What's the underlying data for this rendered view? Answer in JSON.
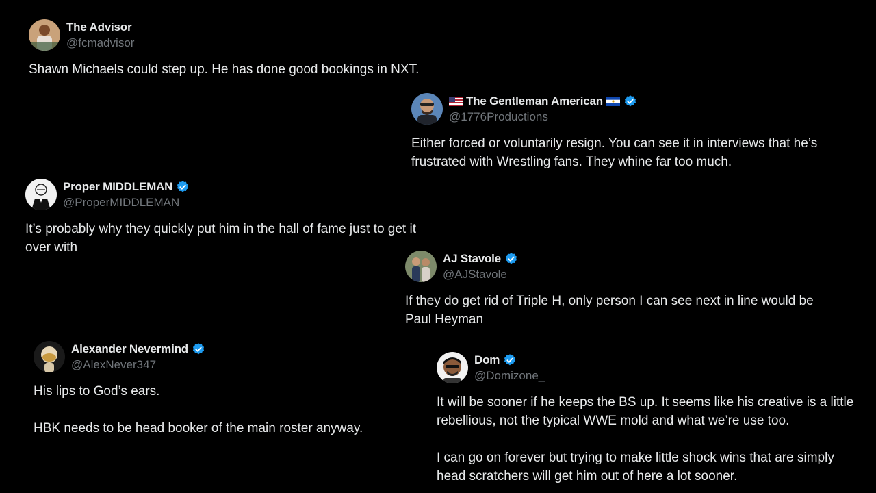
{
  "colors": {
    "background": "#000000",
    "text": "#e7e9ea",
    "secondary": "#71767b",
    "verified": "#1d9bf0"
  },
  "tweets": [
    {
      "name": "The Advisor",
      "handle": "@fcmadvisor",
      "verified": false,
      "text": "Shawn Michaels could step up. He has done good bookings in NXT."
    },
    {
      "name": "The Gentleman American",
      "handle": "@1776Productions",
      "verified": true,
      "flags": [
        "us-flag-icon",
        "el-salvador-flag-icon"
      ],
      "text": "Either forced or voluntarily resign. You can see it in interviews that he’s\nfrustrated with Wrestling fans. They whine far too much."
    },
    {
      "name": "Proper MIDDLEMAN",
      "handle": "@ProperMIDDLEMAN",
      "verified": true,
      "text": "It’s probably why they quickly put him in the hall of fame just to get it\nover with"
    },
    {
      "name": "AJ Stavole",
      "handle": "@AJStavole",
      "verified": true,
      "text": "If they do get rid of Triple H, only person I can see next in line would be\nPaul Heyman"
    },
    {
      "name": "Alexander Nevermind",
      "handle": "@AlexNever347",
      "verified": true,
      "text": "His lips to God’s ears.\n\nHBK needs to be head booker of the main roster anyway."
    },
    {
      "name": "Dom",
      "handle": "@Domizone_",
      "verified": true,
      "text": "It will be sooner if he keeps the BS up. It seems like his creative is a little\nrebellious, not the typical WWE mold and what we’re use too.\n\nI can go on forever but trying to make little shock wins that are simply\nhead scratchers will get him out of here a lot sooner."
    }
  ]
}
